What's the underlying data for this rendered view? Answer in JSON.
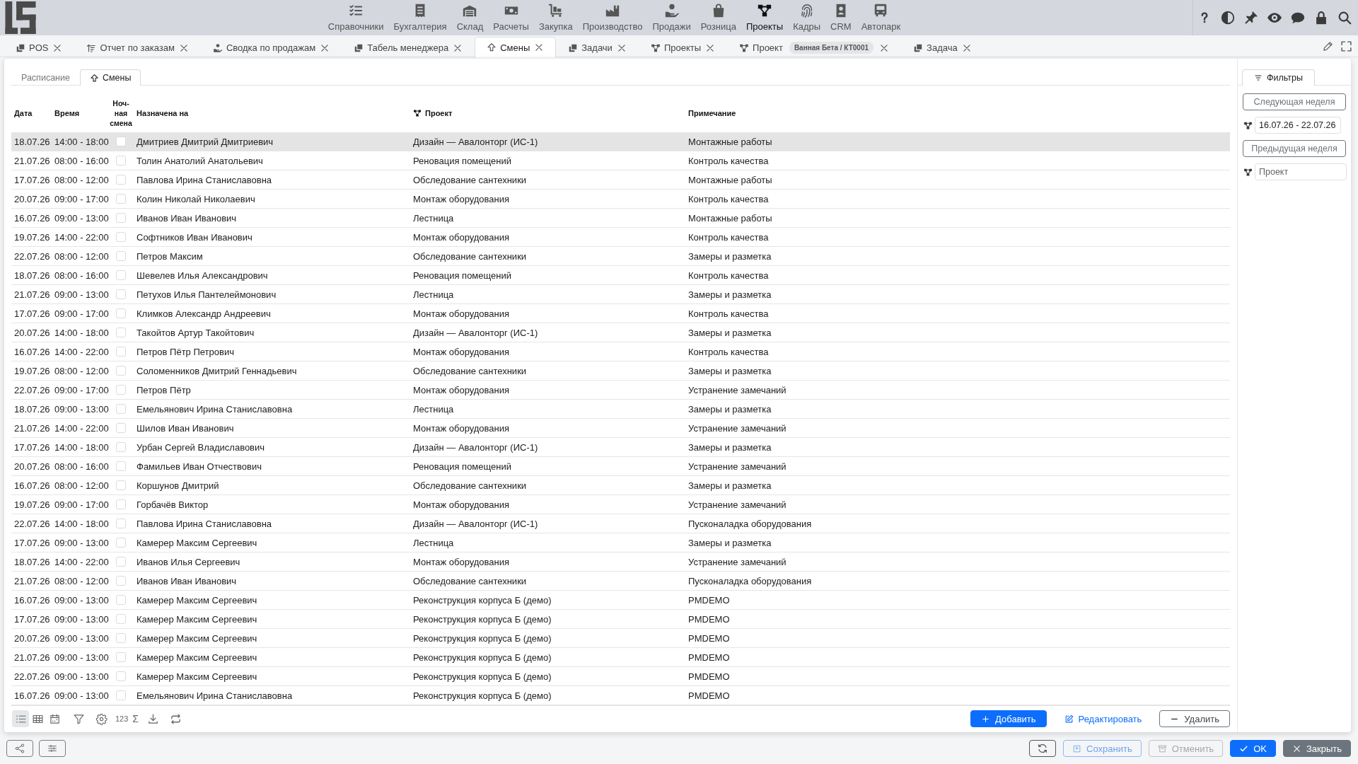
{
  "top_nav": {
    "items": [
      {
        "label": "Справочники",
        "selected": false
      },
      {
        "label": "Бухгалтерия",
        "selected": false
      },
      {
        "label": "Склад",
        "selected": false
      },
      {
        "label": "Расчеты",
        "selected": false
      },
      {
        "label": "Закупка",
        "selected": false
      },
      {
        "label": "Производство",
        "selected": false
      },
      {
        "label": "Продажи",
        "selected": false
      },
      {
        "label": "Розница",
        "selected": false
      },
      {
        "label": "Проекты",
        "selected": true
      },
      {
        "label": "Кадры",
        "selected": false
      },
      {
        "label": "CRM",
        "selected": false
      },
      {
        "label": "Автопарк",
        "selected": false
      }
    ]
  },
  "tabs": [
    {
      "label": "POS",
      "selected": false
    },
    {
      "label": "Отчет по заказам",
      "selected": false
    },
    {
      "label": "Сводка по продажам",
      "selected": false
    },
    {
      "label": "Табель менеджера",
      "selected": false
    },
    {
      "label": "Смены",
      "selected": true
    },
    {
      "label": "Задачи",
      "selected": false
    },
    {
      "label": "Проекты",
      "selected": false
    },
    {
      "label": "Проект",
      "badge": "Ванная Бета / КТ0001",
      "selected": false
    },
    {
      "label": "Задача",
      "selected": false
    }
  ],
  "subtabs": [
    {
      "label": "Расписание",
      "selected": false
    },
    {
      "label": "Смены",
      "selected": true
    }
  ],
  "table": {
    "columns": [
      "Дата",
      "Время",
      "Ноч-ная смена",
      "Назначена на",
      "Проект",
      "Примечание"
    ],
    "rows": [
      {
        "date": "18.07.26",
        "time": "14:00 - 18:00",
        "night_shift": false,
        "assignee": "Дмитриев Дмитрий Дмитриевич",
        "project": "Дизайн — Авалонторг (ИС-1)",
        "note": "Монтажные работы",
        "selected": true
      },
      {
        "date": "21.07.26",
        "time": "08:00 - 16:00",
        "night_shift": false,
        "assignee": "Толин Анатолий Анатольевич",
        "project": "Реновация помещений",
        "note": "Контроль качества",
        "selected": false
      },
      {
        "date": "17.07.26",
        "time": "08:00 - 12:00",
        "night_shift": false,
        "assignee": "Павлова Ирина Станиславовна",
        "project": "Обследование сантехники",
        "note": "Монтажные работы",
        "selected": false
      },
      {
        "date": "20.07.26",
        "time": "09:00 - 17:00",
        "night_shift": false,
        "assignee": "Колин Николай Николаевич",
        "project": "Монтаж оборудования",
        "note": "Контроль качества",
        "selected": false
      },
      {
        "date": "16.07.26",
        "time": "09:00 - 13:00",
        "night_shift": false,
        "assignee": "Иванов Иван Иванович",
        "project": "Лестница",
        "note": "Монтажные работы",
        "selected": false
      },
      {
        "date": "19.07.26",
        "time": "14:00 - 22:00",
        "night_shift": false,
        "assignee": "Софтников Иван Иванович",
        "project": "Монтаж оборудования",
        "note": "Контроль качества",
        "selected": false
      },
      {
        "date": "22.07.26",
        "time": "08:00 - 12:00",
        "night_shift": false,
        "assignee": "Петров Максим",
        "project": "Обследование сантехники",
        "note": "Замеры и разметка",
        "selected": false
      },
      {
        "date": "18.07.26",
        "time": "08:00 - 16:00",
        "night_shift": false,
        "assignee": "Шевелев Илья Александрович",
        "project": "Реновация помещений",
        "note": "Контроль качества",
        "selected": false
      },
      {
        "date": "21.07.26",
        "time": "09:00 - 13:00",
        "night_shift": false,
        "assignee": "Петухов Илья Пантелеймонович",
        "project": "Лестница",
        "note": "Замеры и разметка",
        "selected": false
      },
      {
        "date": "17.07.26",
        "time": "09:00 - 17:00",
        "night_shift": false,
        "assignee": "Климков Александр Андреевич",
        "project": "Монтаж оборудования",
        "note": "Контроль качества",
        "selected": false
      },
      {
        "date": "20.07.26",
        "time": "14:00 - 18:00",
        "night_shift": false,
        "assignee": "Такойтов Артур Такойтович",
        "project": "Дизайн — Авалонторг (ИС-1)",
        "note": "Замеры и разметка",
        "selected": false
      },
      {
        "date": "16.07.26",
        "time": "14:00 - 22:00",
        "night_shift": false,
        "assignee": "Петров Пётр Петрович",
        "project": "Монтаж оборудования",
        "note": "Контроль качества",
        "selected": false
      },
      {
        "date": "19.07.26",
        "time": "08:00 - 12:00",
        "night_shift": false,
        "assignee": "Соломенников Дмитрий Геннадьевич",
        "project": "Обследование сантехники",
        "note": "Замеры и разметка",
        "selected": false
      },
      {
        "date": "22.07.26",
        "time": "09:00 - 17:00",
        "night_shift": false,
        "assignee": "Петров Пётр",
        "project": "Монтаж оборудования",
        "note": "Устранение замечаний",
        "selected": false
      },
      {
        "date": "18.07.26",
        "time": "09:00 - 13:00",
        "night_shift": false,
        "assignee": "Емельянович Ирина Станиславовна",
        "project": "Лестница",
        "note": "Замеры и разметка",
        "selected": false
      },
      {
        "date": "21.07.26",
        "time": "14:00 - 22:00",
        "night_shift": false,
        "assignee": "Шилов Иван Иванович",
        "project": "Монтаж оборудования",
        "note": "Устранение замечаний",
        "selected": false
      },
      {
        "date": "17.07.26",
        "time": "14:00 - 18:00",
        "night_shift": false,
        "assignee": "Урбан Сергей Владиславович",
        "project": "Дизайн — Авалонторг (ИС-1)",
        "note": "Замеры и разметка",
        "selected": false
      },
      {
        "date": "20.07.26",
        "time": "08:00 - 16:00",
        "night_shift": false,
        "assignee": "Фамильев Иван Отчествович",
        "project": "Реновация помещений",
        "note": "Устранение замечаний",
        "selected": false
      },
      {
        "date": "16.07.26",
        "time": "08:00 - 12:00",
        "night_shift": false,
        "assignee": "Коршунов Дмитрий",
        "project": "Обследование сантехники",
        "note": "Замеры и разметка",
        "selected": false
      },
      {
        "date": "19.07.26",
        "time": "09:00 - 17:00",
        "night_shift": false,
        "assignee": "Горбачёв Виктор",
        "project": "Монтаж оборудования",
        "note": "Устранение замечаний",
        "selected": false
      },
      {
        "date": "22.07.26",
        "time": "14:00 - 18:00",
        "night_shift": false,
        "assignee": "Павлова Ирина Станиславовна",
        "project": "Дизайн — Авалонторг (ИС-1)",
        "note": "Пусконаладка оборудования",
        "selected": false
      },
      {
        "date": "17.07.26",
        "time": "09:00 - 13:00",
        "night_shift": false,
        "assignee": "Камерер Максим Сергеевич",
        "project": "Лестница",
        "note": "Замеры и разметка",
        "selected": false
      },
      {
        "date": "18.07.26",
        "time": "14:00 - 22:00",
        "night_shift": false,
        "assignee": "Иванов Илья Сергеевич",
        "project": "Монтаж оборудования",
        "note": "Устранение замечаний",
        "selected": false
      },
      {
        "date": "21.07.26",
        "time": "08:00 - 12:00",
        "night_shift": false,
        "assignee": "Иванов Иван Иванович",
        "project": "Обследование сантехники",
        "note": "Пусконаладка оборудования",
        "selected": false
      },
      {
        "date": "16.07.26",
        "time": "09:00 - 13:00",
        "night_shift": false,
        "assignee": "Камерер Максим Сергеевич",
        "project": "Реконструкция корпуса Б (демо)",
        "note": "PMDEMO",
        "selected": false
      },
      {
        "date": "17.07.26",
        "time": "09:00 - 13:00",
        "night_shift": false,
        "assignee": "Камерер Максим Сергеевич",
        "project": "Реконструкция корпуса Б (демо)",
        "note": "PMDEMO",
        "selected": false
      },
      {
        "date": "20.07.26",
        "time": "09:00 - 13:00",
        "night_shift": false,
        "assignee": "Камерер Максим Сергеевич",
        "project": "Реконструкция корпуса Б (демо)",
        "note": "PMDEMO",
        "selected": false
      },
      {
        "date": "21.07.26",
        "time": "09:00 - 13:00",
        "night_shift": false,
        "assignee": "Камерер Максим Сергеевич",
        "project": "Реконструкция корпуса Б (демо)",
        "note": "PMDEMO",
        "selected": false
      },
      {
        "date": "22.07.26",
        "time": "09:00 - 13:00",
        "night_shift": false,
        "assignee": "Камерер Максим Сергеевич",
        "project": "Реконструкция корпуса Б (демо)",
        "note": "PMDEMO",
        "selected": false
      },
      {
        "date": "16.07.26",
        "time": "09:00 - 13:00",
        "night_shift": false,
        "assignee": "Емельянович Ирина Станиславовна",
        "project": "Реконструкция корпуса Б (демо)",
        "note": "PMDEMO",
        "selected": false
      }
    ]
  },
  "toolbar": {
    "views": [
      {
        "selected": true
      },
      {
        "selected": false
      },
      {
        "selected": false
      }
    ],
    "numbering": "123",
    "sum": "Σ",
    "actions": [
      {
        "label": "Добавить",
        "kind": "primary"
      },
      {
        "label": "Редактировать",
        "kind": "link"
      },
      {
        "label": "Удалить",
        "kind": "outline"
      }
    ]
  },
  "filters": {
    "tab": "Фильтры",
    "next_week": "Следующая неделя",
    "period": "16.07.26 - 22.07.26",
    "previous_week": "Предыдущая неделя",
    "project_placeholder": "Проект"
  },
  "footer": {
    "buttons": [
      {
        "label": "Сохранить",
        "kind": "outline-primary",
        "disabled": true
      },
      {
        "label": "Отменить",
        "kind": "outline",
        "disabled": true
      },
      {
        "label": "OK",
        "kind": "primary",
        "disabled": false
      },
      {
        "label": "Закрыть",
        "kind": "secondary",
        "disabled": false
      }
    ]
  }
}
